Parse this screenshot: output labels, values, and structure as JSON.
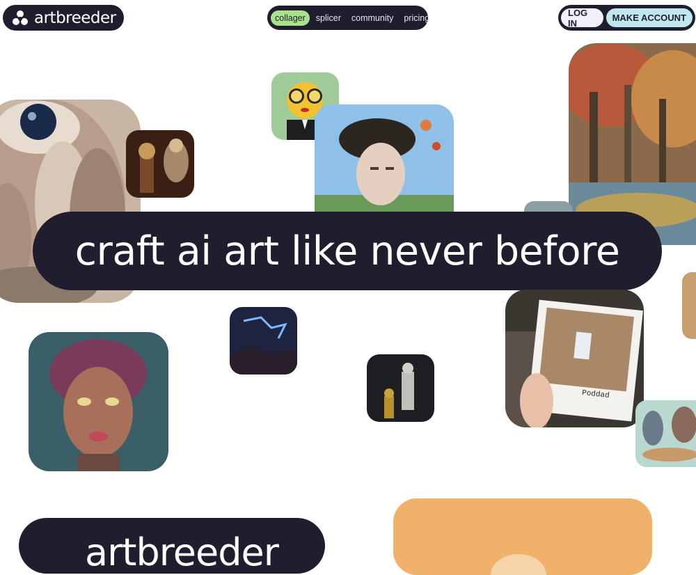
{
  "header": {
    "logo_text": "artbreeder",
    "nav": [
      {
        "label": "collager",
        "active": true
      },
      {
        "label": "splicer",
        "active": false
      },
      {
        "label": "community",
        "active": false
      },
      {
        "label": "pricing",
        "active": false
      }
    ],
    "login_label": "LOG IN",
    "make_account_label": "MAKE ACCOUNT"
  },
  "hero": {
    "headline": "craft ai art like never before"
  },
  "polaroid_caption": "Poddad",
  "footer_logo_text": "artbreeder",
  "colors": {
    "dark": "#1f1d2e",
    "nav_active": "#a8e28a",
    "make_account": "#bfe8ec",
    "login": "#f2f0fa",
    "bottom_card": "#f0b26a"
  }
}
